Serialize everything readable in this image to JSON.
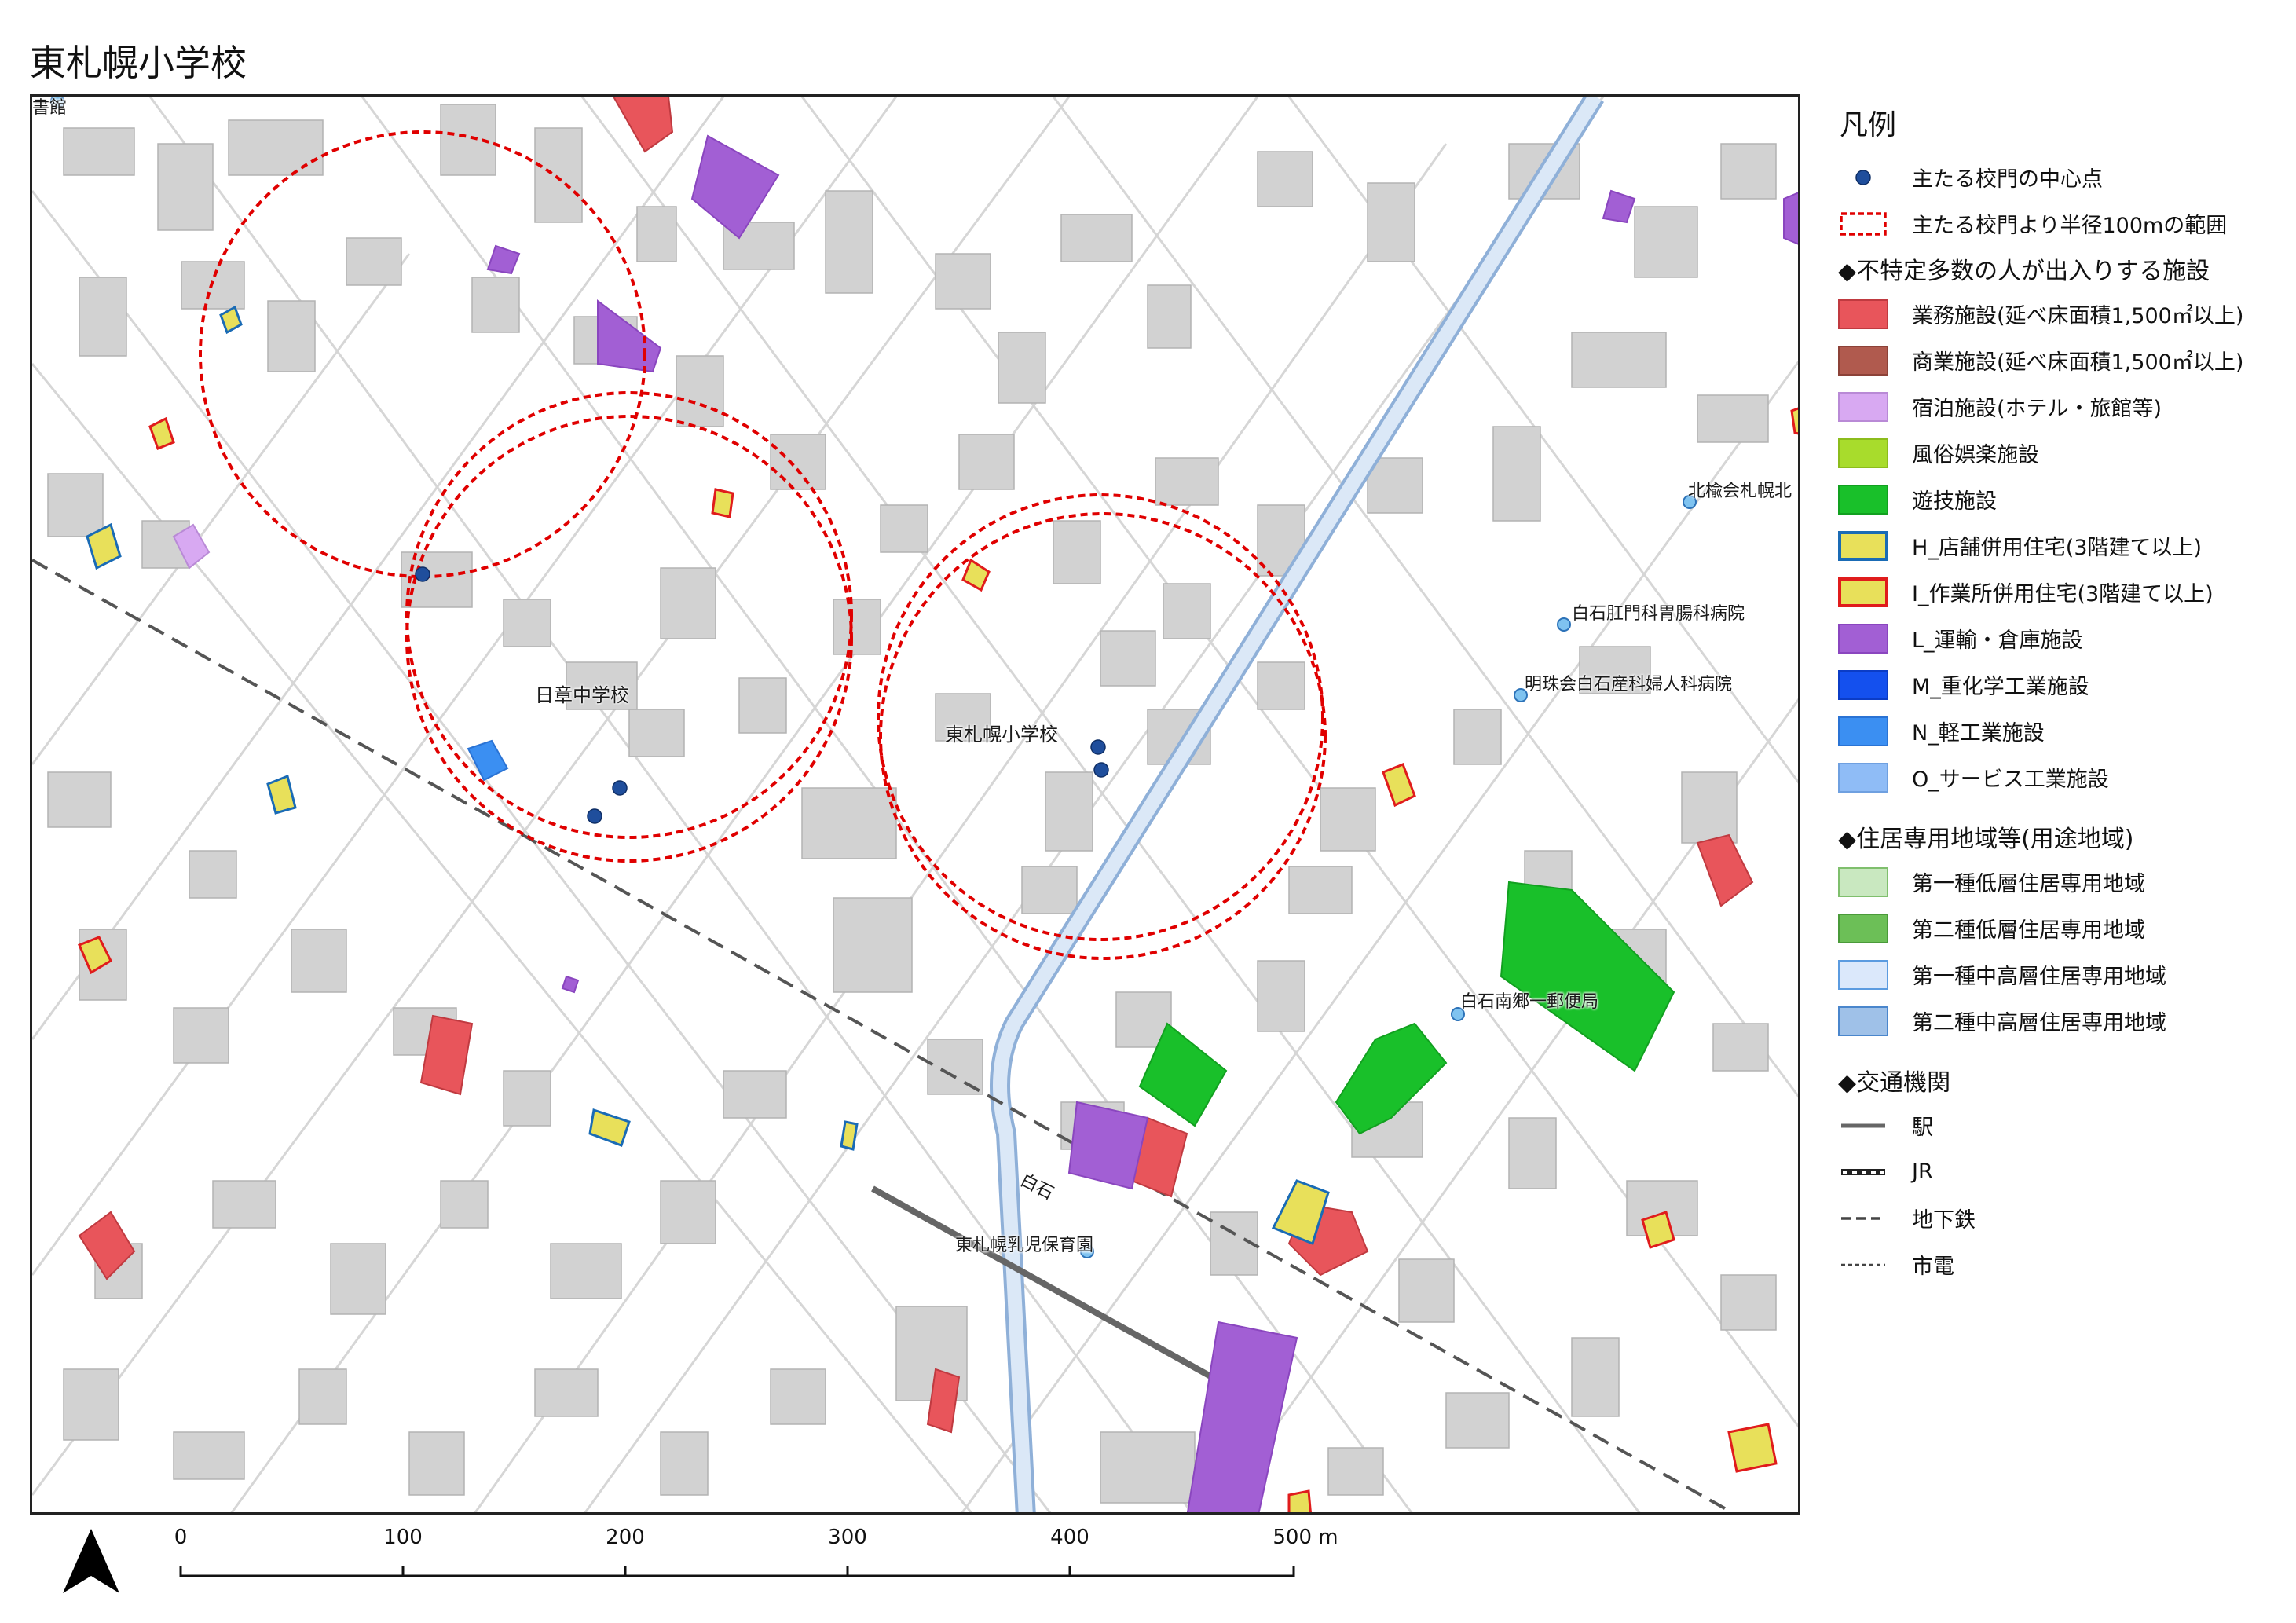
{
  "title": "東札幌小学校",
  "map": {
    "labels": {
      "school_junior": "日章中学校",
      "school_elementary": "東札幌小学校",
      "station": "白石",
      "nursery": "東札幌乳児保育園",
      "post_office": "白石南郷一郵便局",
      "hospital_1": "白石肛門科胃腸科病院",
      "hospital_2": "明珠会白石産科婦人科病院",
      "hospital_3": "北楡会札幌北",
      "library_fragment": "書館"
    },
    "colors": {
      "building": "#d0d0d0",
      "road_edge": "#cfcfcf",
      "buffer_circle": "#e00000",
      "gate_point": "#1f4e9c",
      "subway_line": "#555555",
      "canal": "#c6daf0"
    }
  },
  "legend": {
    "title": "凡例",
    "items": [
      {
        "label": "主たる校門の中心点",
        "kind": "dot",
        "color": "#1f4e9c"
      },
      {
        "label": "主たる校門より半径100mの範囲",
        "kind": "dashed-box",
        "color": "#e00000"
      }
    ],
    "section_facilities": "◆不特定多数の人が出入りする施設",
    "facilities": [
      {
        "label": "業務施設(延べ床面積1,500㎡以上)",
        "fill": "#e8555b",
        "border": "#c03a40"
      },
      {
        "label": "商業施設(延べ床面積1,500㎡以上)",
        "fill": "#b05a4e",
        "border": "#8c4238"
      },
      {
        "label": "宿泊施設(ホテル・旅館等)",
        "fill": "#d8a9f2",
        "border": "#b98ad6"
      },
      {
        "label": "風俗娯楽施設",
        "fill": "#a8dc2c",
        "border": "#8cbc1c"
      },
      {
        "label": "遊技施設",
        "fill": "#19c02a",
        "border": "#12a020"
      },
      {
        "label": "H_店舗併用住宅(3階建て以上)",
        "fill": "#e8e05a",
        "border": "#1a6bb5"
      },
      {
        "label": "I_作業所併用住宅(3階建て以上)",
        "fill": "#e8e05a",
        "border": "#e01c1c"
      },
      {
        "label": "L_運輸・倉庫施設",
        "fill": "#a25fd4",
        "border": "#8a46bf"
      },
      {
        "label": "M_重化学工業施設",
        "fill": "#1450ee",
        "border": "#0b3cc6"
      },
      {
        "label": "N_軽工業施設",
        "fill": "#3b8ff2",
        "border": "#2a73d4"
      },
      {
        "label": "O_サービス工業施設",
        "fill": "#8fbcf6",
        "border": "#6fa0e0"
      }
    ],
    "section_zoning": "◆住居専用地域等(用途地域)",
    "zoning": [
      {
        "label": "第一種低層住居専用地域",
        "fill": "#c9e8c0",
        "border": "#7fbf6d"
      },
      {
        "label": "第二種低層住居専用地域",
        "fill": "#6cbf57",
        "border": "#4a9a3a"
      },
      {
        "label": "第一種中高層住居専用地域",
        "fill": "#dbe8fb",
        "border": "#5b9be0"
      },
      {
        "label": "第二種中高層住居専用地域",
        "fill": "#9fc1e8",
        "border": "#4a86cc"
      }
    ],
    "section_transport": "◆交通機関",
    "transport": [
      {
        "label": "駅",
        "kind": "station"
      },
      {
        "label": "JR",
        "kind": "jr"
      },
      {
        "label": "地下鉄",
        "kind": "subway"
      },
      {
        "label": "市電",
        "kind": "tram"
      }
    ]
  },
  "scale": {
    "ticks": [
      "0",
      "100",
      "200",
      "300",
      "400",
      "500 m"
    ]
  }
}
